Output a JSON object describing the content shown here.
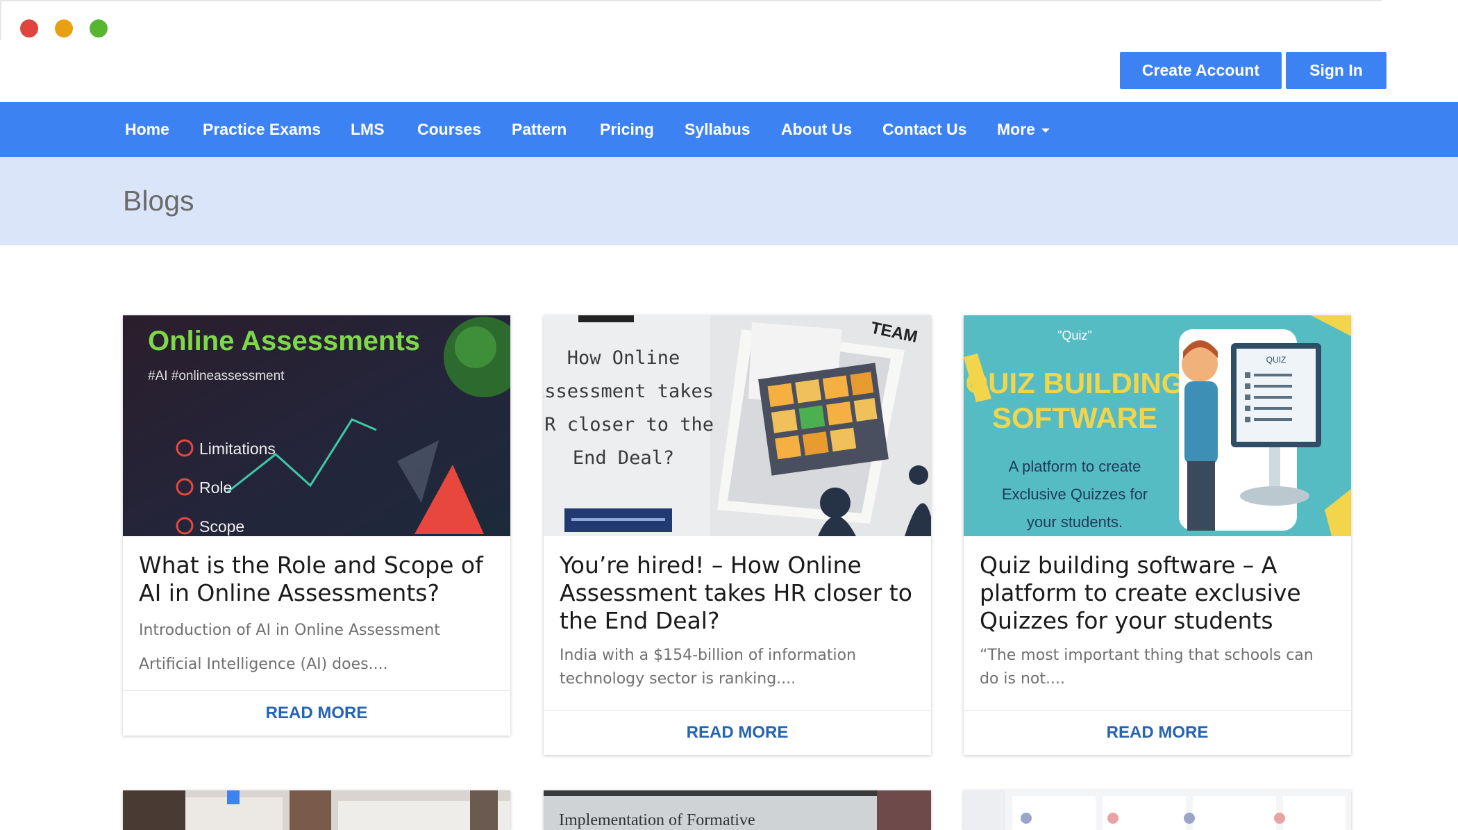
{
  "header": {
    "create_account": "Create Account",
    "sign_in": "Sign In"
  },
  "nav": {
    "items": [
      "Home",
      "Practice Exams",
      "LMS",
      "Courses",
      "Pattern",
      "Pricing",
      "Syllabus",
      "About Us",
      "Contact Us"
    ],
    "more": "More"
  },
  "page": {
    "title": "Blogs"
  },
  "colors": {
    "accent": "#3d82f3",
    "title_band": "#dae5f9",
    "read_more": "#2563b4"
  },
  "cards": [
    {
      "title": "What is the Role and Scope of AI in Online Assessments?",
      "excerpt_1": "Introduction of AI in Online Assessment",
      "excerpt_2": "Artificial Intelligence (AI) does....",
      "read_more": "READ MORE",
      "image": {
        "heading": "Online Assessments",
        "tag": "#AI #onlineassessment",
        "bullets": [
          "Limitations",
          "Role",
          "Scope"
        ]
      }
    },
    {
      "title": "You’re hired! – How Online Assessment takes HR closer to the End Deal?",
      "excerpt_1": "India with a $154-billion of information technology sector is ranking....",
      "read_more": "READ MORE",
      "image": {
        "lines": [
          "How Online",
          "Assessment takes",
          "HR closer to the",
          "End Deal?"
        ],
        "team": "TEAM"
      }
    },
    {
      "title": "Quiz building software – A platform to create exclusive Quizzes for your students",
      "excerpt_1": "“The most important thing that schools can do is not....",
      "read_more": "READ MORE",
      "image": {
        "quote": "\"Quiz\"",
        "heading_1": "QUIZ BUILDING",
        "heading_2": "SOFTWARE",
        "sub": [
          "A platform to create",
          "Exclusive Quizzes for",
          "your students."
        ],
        "screen": "QUIZ"
      }
    }
  ],
  "row2": {
    "card_2_text": "Implementation of Formative"
  }
}
